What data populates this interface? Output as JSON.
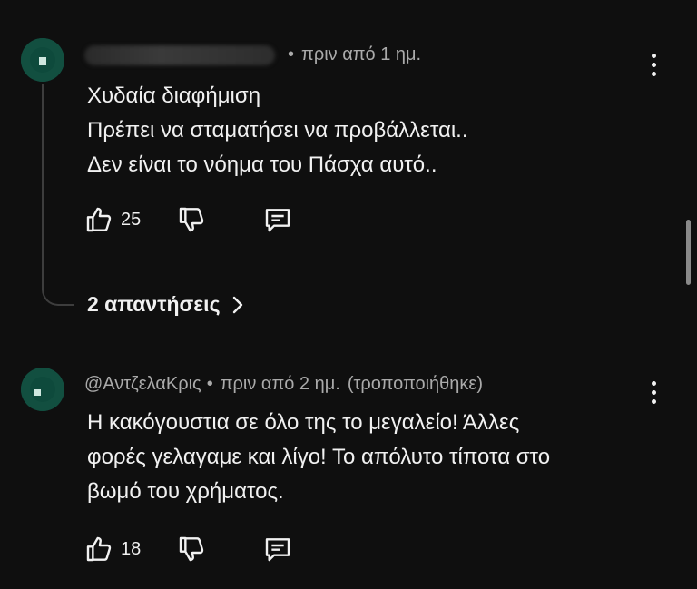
{
  "comments": [
    {
      "author": "",
      "time": "πριν από 1 ημ.",
      "edited": "",
      "lines": [
        "Χυδαία διαφήμιση",
        "Πρέπει να σταματήσει να προβάλλεται..",
        "Δεν είναι το νόημα του Πάσχα αυτό.."
      ],
      "likes": "25",
      "replies_label": "2 απαντήσεις"
    },
    {
      "author": "@ΑντζελαΚρις",
      "time": "πριν από 2 ημ.",
      "edited": "(τροποποιήθηκε)",
      "lines": [
        "Η κακόγουστια σε όλο της το μεγαλείο! Άλλες",
        "φορές γελαγαμε και λίγο! Το απόλυτο τίποτα στο",
        "βωμό του χρήματος."
      ],
      "likes": "18"
    }
  ],
  "icons": {
    "like": "thumb-up-icon",
    "dislike": "thumb-down-icon",
    "reply": "comment-icon",
    "menu": "more-vertical-icon",
    "replies_arrow": "chevron-right-icon"
  },
  "colors": {
    "background": "#0f0f0f",
    "text": "#f1f1f1",
    "meta": "#aaaaaa",
    "avatar": "#0e4a3c"
  }
}
